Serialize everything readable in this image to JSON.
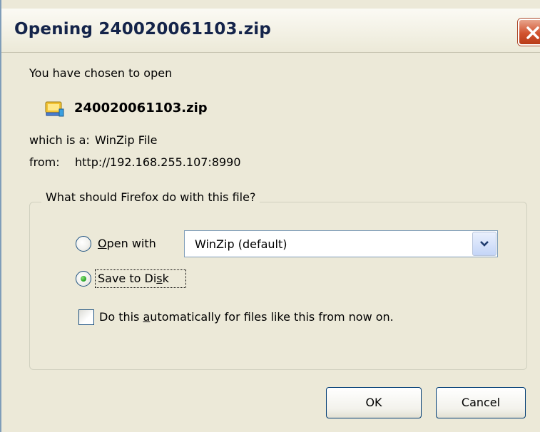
{
  "window": {
    "title": "Opening 240020061103.zip"
  },
  "dialog": {
    "intro": "You have chosen to open",
    "filename": "240020061103.zip",
    "type_label": "which is a:",
    "type_value": "WinZip File",
    "from_label": "from:",
    "from_value": "http://192.168.255.107:8990"
  },
  "group": {
    "legend": "What should Firefox do with this file?",
    "open_with": {
      "pre": "",
      "access": "O",
      "post": "pen with",
      "selected": false
    },
    "app_select": {
      "value": "WinZip (default)"
    },
    "save_to_disk": {
      "pre": "Save to Di",
      "access": "s",
      "post": "k",
      "selected": true
    },
    "auto": {
      "pre": "Do this ",
      "access": "a",
      "post": "utomatically for files like this from now on.",
      "checked": false
    }
  },
  "buttons": {
    "ok": "OK",
    "cancel": "Cancel"
  },
  "icons": {
    "file": "zip-file-icon",
    "close": "close-icon",
    "dropdown": "chevron-down-icon"
  },
  "colors": {
    "dialog_bg": "#ece9d8",
    "title_text": "#14244a",
    "close_red": "#d2532f",
    "radio_green": "#21a121",
    "border_blue": "#7f9db9"
  }
}
